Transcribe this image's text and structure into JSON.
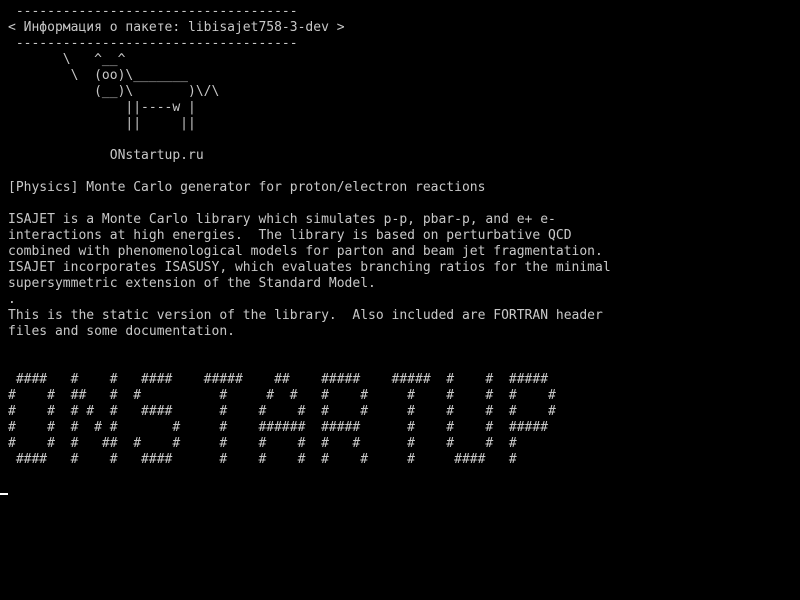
{
  "terminal": {
    "foreground": "#c8c8c8",
    "background": "#000000",
    "lines": [
      " ------------------------------------",
      "< Информация о пакете: libisajet758-3-dev >",
      " ------------------------------------",
      "       \\   ^__^",
      "        \\  (oo)\\_______",
      "           (__)\\       )\\/\\",
      "               ||----w |",
      "               ||     ||",
      "",
      "             ONstartup.ru",
      "",
      "[Physics] Monte Carlo generator for proton/electron reactions",
      "",
      "ISAJET is a Monte Carlo library which simulates p-p, pbar-p, and e+ e-",
      "interactions at high energies.  The library is based on perturbative QCD",
      "combined with phenomenological models for parton and beam jet fragmentation.",
      "ISAJET incorporates ISASUSY, which evaluates branching ratios for the minimal",
      "supersymmetric extension of the Standard Model.",
      ".",
      "This is the static version of the library.  Also included are FORTRAN header",
      "files and some documentation.",
      "",
      "",
      " ####   #    #   ####    #####    ##    #####    #####  #    #  #####",
      "#    #  ##   #  #          #     #  #   #    #     #    #    #  #    #",
      "#    #  # #  #   ####      #    #    #  #    #     #    #    #  #    #",
      "#    #  #  # #       #     #    ######  #####      #    #    #  #####",
      "#    #  #   ##  #    #     #    #    #  #   #      #    #    #  #",
      " ####   #    #   ####      #    #    #  #    #     #     ####   #"
    ]
  }
}
